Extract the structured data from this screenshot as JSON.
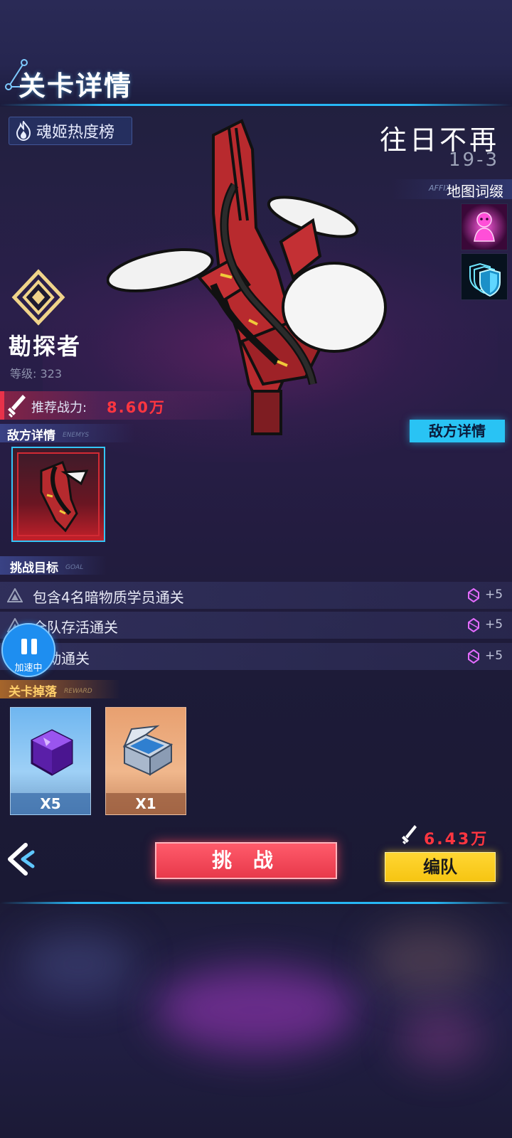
{
  "header": {
    "title": "关卡详情"
  },
  "hot_rank_button": {
    "label": "魂姬热度榜"
  },
  "stage": {
    "name": "往日不再",
    "number": "19-3"
  },
  "affix": {
    "en": "AFFIX",
    "label": "地图词缀",
    "icons": [
      "magenta-figure-icon",
      "triple-shield-icon"
    ]
  },
  "rank": {
    "name": "勘探者",
    "level": "等级: 323"
  },
  "recommended_power": {
    "label": "推荐战力:",
    "value": "8.60万"
  },
  "enemy_section": {
    "title": "敌方详情",
    "title_en": "ENEMYS",
    "detail_button": "敌方详情"
  },
  "goal_section": {
    "title": "挑战目标",
    "title_en": "GOAL",
    "goals": [
      {
        "text": "包含4名暗物质学员通关",
        "reward": "+5"
      },
      {
        "text": "全队存活通关",
        "reward": "+5"
      },
      {
        "text": "自动通关",
        "reward": "+5"
      }
    ]
  },
  "accelerate": {
    "label": "加速中"
  },
  "drop_section": {
    "title": "关卡掉落",
    "title_en": "REWARD",
    "items": [
      {
        "name": "purple-cube",
        "quantity": "X5"
      },
      {
        "name": "silver-case",
        "quantity": "X1"
      }
    ]
  },
  "team_power": {
    "value": "6.43万"
  },
  "buttons": {
    "challenge": "挑 战",
    "team": "编队"
  },
  "colors": {
    "accent_cyan": "#29c3f4",
    "power_red": "#ff3640",
    "team_yellow": "#f6c512",
    "challenge_red": "#e8394b"
  }
}
